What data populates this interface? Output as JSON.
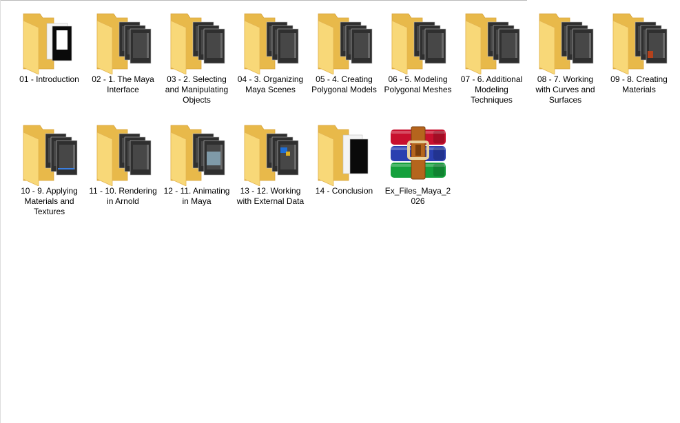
{
  "items": [
    {
      "name": "01 - Introduction",
      "type": "folder",
      "preview": "intro"
    },
    {
      "name": "02 - 1. The Maya Interface",
      "type": "folder",
      "preview": "dark"
    },
    {
      "name": "03 - 2. Selecting and Manipulating Objects",
      "type": "folder",
      "preview": "dark"
    },
    {
      "name": "04 - 3. Organizing Maya Scenes",
      "type": "folder",
      "preview": "dark"
    },
    {
      "name": "05 - 4. Creating Polygonal Models",
      "type": "folder",
      "preview": "dark"
    },
    {
      "name": "06 - 5. Modeling Polygonal Meshes",
      "type": "folder",
      "preview": "dark"
    },
    {
      "name": "07 - 6. Additional Modeling Techniques",
      "type": "folder",
      "preview": "dark"
    },
    {
      "name": "08 - 7.  Working with Curves and Surfaces",
      "type": "folder",
      "preview": "dark"
    },
    {
      "name": "09 - 8. Creating Materials",
      "type": "folder",
      "preview": "dark-red"
    },
    {
      "name": "10 - 9.  Applying Materials and Textures",
      "type": "folder",
      "preview": "dark-blue"
    },
    {
      "name": "11 - 10. Rendering in Arnold",
      "type": "folder",
      "preview": "dark"
    },
    {
      "name": "12 - 11. Animating in Maya",
      "type": "folder",
      "preview": "dark-teal"
    },
    {
      "name": "13 - 12. Working with External Data",
      "type": "folder",
      "preview": "dark-color"
    },
    {
      "name": "14 - Conclusion",
      "type": "folder",
      "preview": "conclusion"
    },
    {
      "name": "Ex_Files_Maya_2026",
      "type": "archive",
      "preview": "winrar"
    }
  ],
  "colors": {
    "folder_back": "#e8b94a",
    "folder_front": "#f8d878",
    "winrar_red": "#c8102e",
    "winrar_blue": "#2a3fb0",
    "winrar_green": "#14a03c",
    "winrar_strap": "#b5651d"
  }
}
